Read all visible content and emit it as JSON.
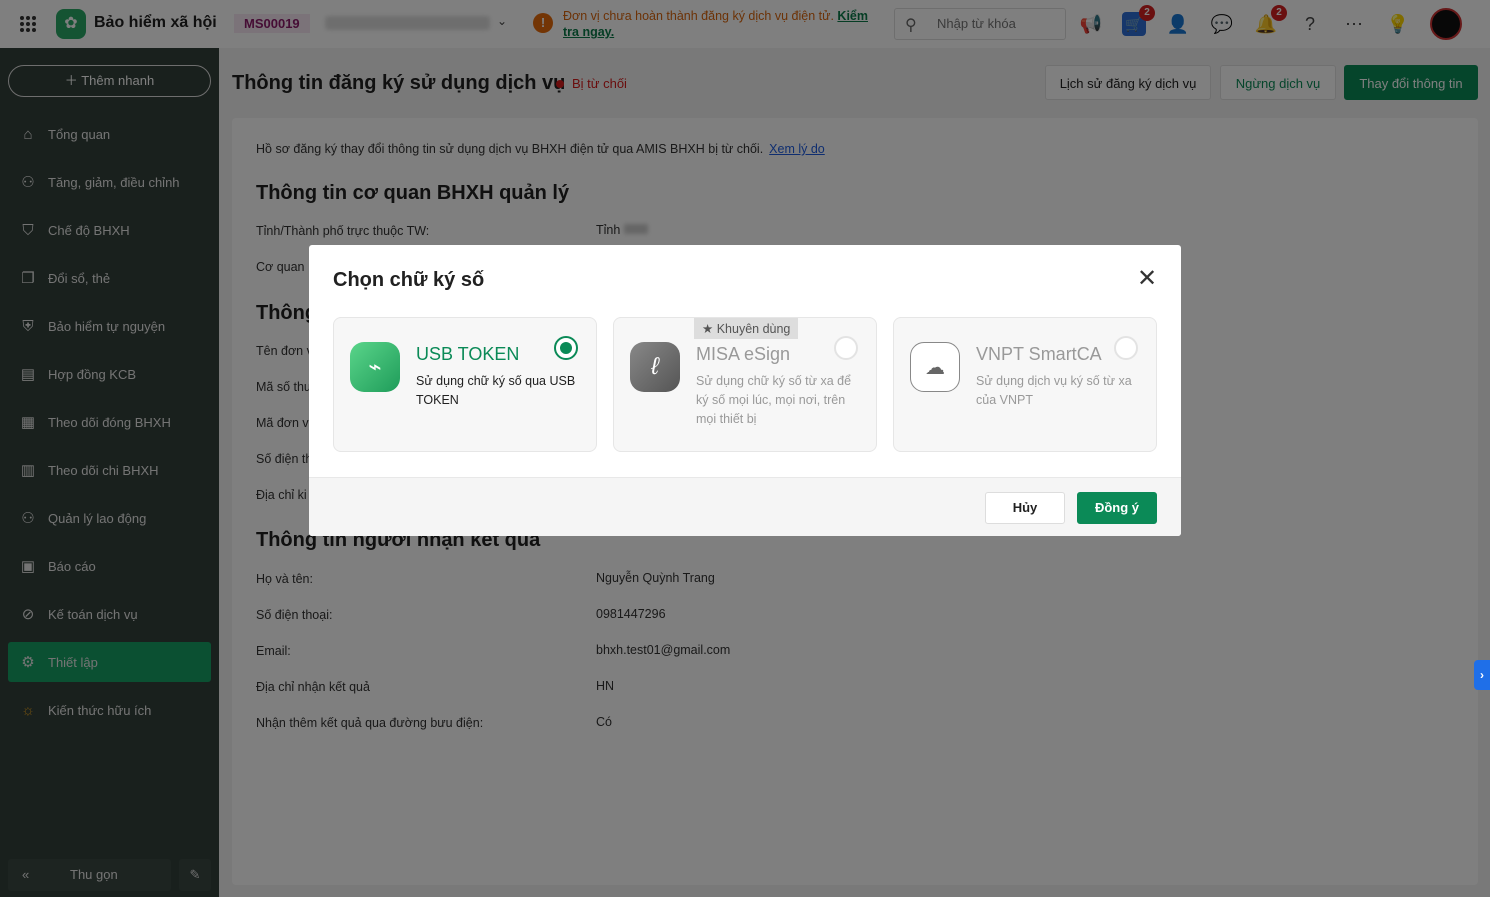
{
  "header": {
    "app_title": "Bảo hiểm xã hội",
    "unit_code": "MS00019",
    "warning": "Đơn vị chưa hoàn thành đăng ký dịch vụ điện tử.",
    "warning_link": "Kiểm tra ngay.",
    "search_placeholder": "Nhập từ khóa",
    "cart_badge": "2",
    "notif_badge": "2"
  },
  "sidebar": {
    "quick_add": "Thêm nhanh",
    "items": [
      {
        "label": "Tổng quan",
        "icon": "home-icon"
      },
      {
        "label": "Tăng, giảm, điều chỉnh",
        "icon": "user-adjust-icon"
      },
      {
        "label": "Chế độ BHXH",
        "icon": "shield-icon"
      },
      {
        "label": "Đổi sổ, thẻ",
        "icon": "card-icon"
      },
      {
        "label": "Bảo hiểm tự nguyện",
        "icon": "shield-check-icon"
      },
      {
        "label": "Hợp đồng KCB",
        "icon": "contract-icon"
      },
      {
        "label": "Theo dõi đóng BHXH",
        "icon": "track-icon"
      },
      {
        "label": "Theo dõi chi BHXH",
        "icon": "document-icon"
      },
      {
        "label": "Quản lý lao động",
        "icon": "users-icon"
      },
      {
        "label": "Báo cáo",
        "icon": "report-icon"
      },
      {
        "label": "Kế toán dịch vụ",
        "icon": "accounting-icon"
      },
      {
        "label": "Thiết lập",
        "icon": "gear-icon",
        "active": true
      },
      {
        "label": "Kiến thức hữu ích",
        "icon": "knowledge-icon"
      }
    ],
    "collapse": "Thu gọn"
  },
  "page": {
    "title": "Thông tin đăng ký sử dụng dịch vụ",
    "status": "Bị từ chối",
    "status_color": "#d41a1a",
    "buttons": {
      "history": "Lịch sử đăng ký dịch vụ",
      "stop": "Ngừng dịch vụ",
      "change": "Thay đổi thông tin"
    },
    "notice": "Hồ sơ đăng ký thay đổi thông tin sử dụng dịch vụ BHXH điện tử qua AMIS BHXH bị từ chối.",
    "notice_link": "Xem lý do",
    "section1": "Thông tin cơ quan BHXH quản lý",
    "province_label": "Tỉnh/Thành phố trực thuộc TW:",
    "province_value": "Tỉnh",
    "agency_label": "Cơ quan",
    "section2": "Thông",
    "partial_labels": [
      "Tên đơn v",
      "Mã số thu",
      "Mã đơn v",
      "Số điện th",
      "Địa chỉ ki"
    ],
    "section3": "Thông tin người nhận kết quả",
    "receiver": [
      {
        "label": "Họ và tên:",
        "value": "Nguyễn Quỳnh Trang"
      },
      {
        "label": "Số điện thoại:",
        "value": "0981447296"
      },
      {
        "label": "Email:",
        "value": "bhxh.test01@gmail.com"
      },
      {
        "label": "Địa chỉ nhận kết quả",
        "value": "HN"
      },
      {
        "label": "Nhận thêm kết quả qua đường bưu điện:",
        "value": "Có"
      }
    ]
  },
  "modal": {
    "title": "Chọn chữ ký số",
    "recommended": "Khuyên dùng",
    "options": [
      {
        "name": "USB TOKEN",
        "desc": "Sử dụng chữ ký số qua USB TOKEN",
        "selected": true
      },
      {
        "name": "MISA eSign",
        "desc": "Sử dụng chữ ký số từ xa để ký số mọi lúc, mọi nơi, trên mọi thiết bị",
        "selected": false
      },
      {
        "name": "VNPT SmartCA",
        "desc": "Sử dụng dịch vụ ký số từ xa của VNPT",
        "selected": false
      }
    ],
    "cancel": "Hủy",
    "confirm": "Đồng ý",
    "accent": "#0b8a57"
  }
}
